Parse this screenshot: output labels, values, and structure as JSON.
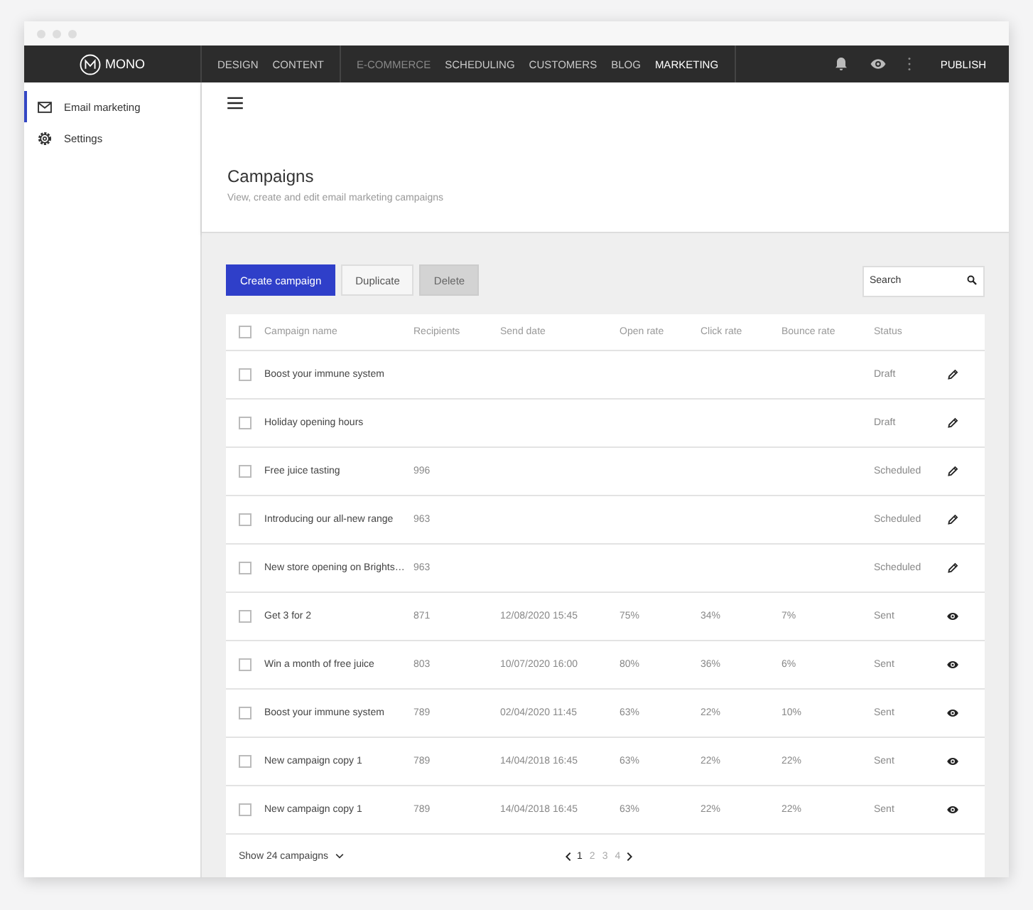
{
  "brand": {
    "name": "MONO"
  },
  "nav_groups": [
    [
      {
        "label": "DESIGN",
        "selected": false,
        "disabled": false
      },
      {
        "label": "CONTENT",
        "selected": false,
        "disabled": false
      }
    ],
    [
      {
        "label": "E-COMMERCE",
        "selected": false,
        "disabled": true
      },
      {
        "label": "SCHEDULING",
        "selected": false,
        "disabled": false
      },
      {
        "label": "CUSTOMERS",
        "selected": false,
        "disabled": false
      },
      {
        "label": "BLOG",
        "selected": false,
        "disabled": false
      },
      {
        "label": "MARKETING",
        "selected": true,
        "disabled": false
      }
    ]
  ],
  "publish": "PUBLISH",
  "sidebar": {
    "items": [
      {
        "label": "Email marketing",
        "selected": true
      },
      {
        "label": "Settings",
        "selected": false
      }
    ]
  },
  "page": {
    "title": "Campaigns",
    "subtitle": "View, create and edit email marketing campaigns"
  },
  "toolbar": {
    "buttons": [
      {
        "label": "Create campaign",
        "kind": "primary"
      },
      {
        "label": "Duplicate",
        "kind": "secondary"
      },
      {
        "label": "Delete",
        "kind": "disabled"
      }
    ],
    "search": {
      "placeholder": "Search"
    }
  },
  "table": {
    "columns": [
      "Campaign name",
      "Recipients",
      "Send date",
      "Open rate",
      "Click rate",
      "Bounce rate",
      "Status"
    ],
    "rows": [
      {
        "checked": false,
        "cells": [
          "Boost your immune system",
          "",
          "",
          "",
          "",
          "",
          "Draft"
        ],
        "kind": "editable"
      },
      {
        "checked": false,
        "cells": [
          "Holiday opening hours",
          "",
          "",
          "",
          "",
          "",
          "Draft"
        ],
        "kind": "editable"
      },
      {
        "checked": false,
        "cells": [
          "Free juice tasting",
          "996",
          "",
          "",
          "",
          "",
          "Scheduled"
        ],
        "kind": "editable"
      },
      {
        "checked": false,
        "cells": [
          "Introducing our all-new range",
          "963",
          "",
          "",
          "",
          "",
          "Scheduled"
        ],
        "kind": "editable"
      },
      {
        "checked": false,
        "cells": [
          "New store opening on Brights…",
          "963",
          "",
          "",
          "",
          "",
          "Scheduled"
        ],
        "kind": "editable"
      },
      {
        "checked": false,
        "cells": [
          "Get 3 for 2",
          "871",
          "12/08/2020 15:45",
          "75%",
          "34%",
          "7%",
          "Sent"
        ],
        "kind": "viewable"
      },
      {
        "checked": false,
        "cells": [
          "Win a month of free juice",
          "803",
          "10/07/2020 16:00",
          "80%",
          "36%",
          "6%",
          "Sent"
        ],
        "kind": "viewable"
      },
      {
        "checked": false,
        "cells": [
          "Boost your immune system",
          "789",
          "02/04/2020 11:45",
          "63%",
          "22%",
          "10%",
          "Sent"
        ],
        "kind": "viewable"
      },
      {
        "checked": false,
        "cells": [
          "New campaign copy 1",
          "789",
          "14/04/2018 16:45",
          "63%",
          "22%",
          "22%",
          "Sent"
        ],
        "kind": "viewable"
      },
      {
        "checked": false,
        "cells": [
          "New campaign copy 1",
          "789",
          "14/04/2018 16:45",
          "63%",
          "22%",
          "22%",
          "Sent"
        ],
        "kind": "viewable"
      }
    ],
    "header_checked": false
  },
  "footer": {
    "page_size": "Show 24 campaigns",
    "pages": [
      {
        "label": "1",
        "selected": true
      },
      {
        "label": "2",
        "selected": false
      },
      {
        "label": "3",
        "selected": false
      },
      {
        "label": "4",
        "selected": false
      }
    ]
  }
}
